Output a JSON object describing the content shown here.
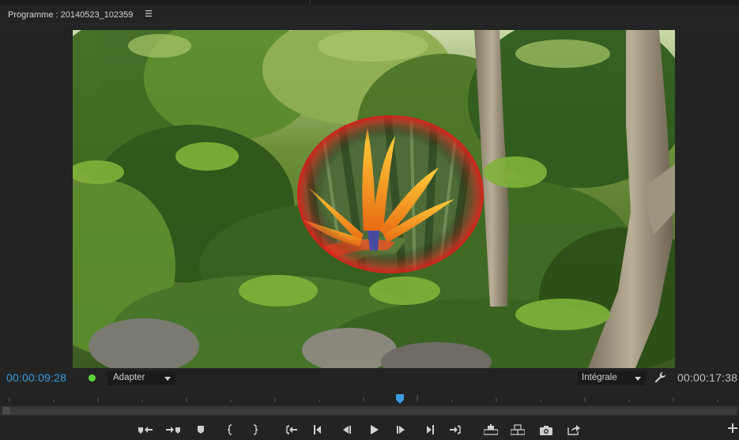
{
  "panel": {
    "title": "Programme : 20140523_102359",
    "menu_icon": "hamburger-menu-icon"
  },
  "viewer": {
    "image_description_icon": "video-frame"
  },
  "info_bar": {
    "current_timecode": "00:00:09:28",
    "status_color": "#5fd43a",
    "fit_label": "Adapter",
    "quality_label": "Intégrale",
    "duration_timecode": "00:00:17:38",
    "timecode_color": "#3b9ce2"
  },
  "transport": {
    "buttons": [
      {
        "name": "marker-in-icon"
      },
      {
        "name": "marker-out-icon"
      },
      {
        "name": "add-marker-icon"
      },
      {
        "name": "mark-in-icon"
      },
      {
        "name": "mark-out-icon"
      },
      {
        "name": "go-to-in-icon"
      },
      {
        "name": "step-back-icon"
      },
      {
        "name": "play-reverse-icon"
      },
      {
        "name": "play-icon"
      },
      {
        "name": "step-forward-icon"
      },
      {
        "name": "go-to-out-icon"
      },
      {
        "name": "next-edit-icon"
      },
      {
        "name": "lift-icon"
      },
      {
        "name": "extract-icon"
      },
      {
        "name": "export-frame-icon"
      },
      {
        "name": "button-editor-icon"
      }
    ],
    "add_button": "add-icon"
  }
}
